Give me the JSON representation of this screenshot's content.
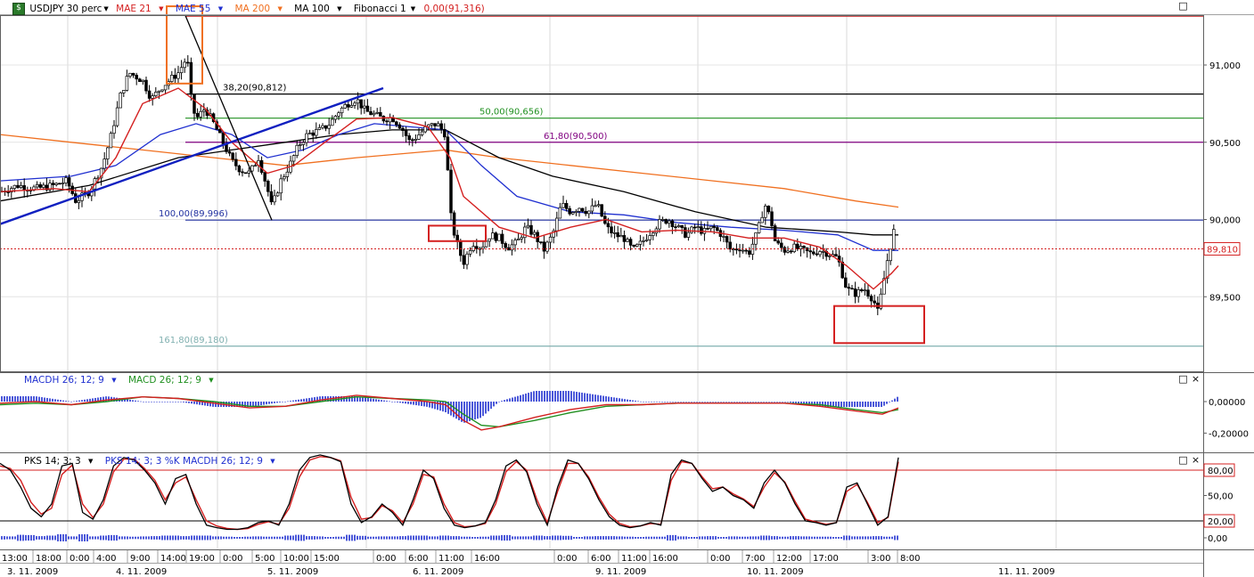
{
  "chart_data": [
    {
      "type": "candlestick",
      "title": "USDJPY 30 perc",
      "indicators": [
        {
          "name": "MAE 21",
          "color": "#d42020"
        },
        {
          "name": "MAE 55",
          "color": "#2030d0"
        },
        {
          "name": "MA 200",
          "color": "#f07020"
        },
        {
          "name": "MA 100",
          "color": "#000000"
        },
        {
          "name": "Fibonacci 1",
          "color": "#000000"
        }
      ],
      "fibonacci_value": "0,00(91,316)",
      "ylim": [
        89.08,
        91.46
      ],
      "y_ticks": [
        "91,000",
        "90,500",
        "90,000",
        "89,500"
      ],
      "y_tick_values": [
        91.0,
        90.5,
        90.0,
        89.5
      ],
      "current_price_label": "89,810",
      "current_price": 89.81,
      "fib_levels": [
        {
          "label": "0,00(91,316)",
          "value": 91.316,
          "color": "#d42020"
        },
        {
          "label": "38,20(90,812)",
          "value": 90.812,
          "color": "#000000"
        },
        {
          "label": "50,00(90,656)",
          "value": 90.656,
          "color": "#209020"
        },
        {
          "label": "61,80(90,500)",
          "value": 90.5,
          "color": "#800080"
        },
        {
          "label": "100,00(89,996)",
          "value": 89.996,
          "color": "#2030a0"
        },
        {
          "label": "161,80(89,180)",
          "value": 89.18,
          "color": "#80b0b0"
        }
      ],
      "price_path": [
        [
          0,
          90.18
        ],
        [
          20,
          90.22
        ],
        [
          40,
          90.2
        ],
        [
          60,
          90.22
        ],
        [
          75,
          90.25
        ],
        [
          85,
          90.12
        ],
        [
          100,
          90.18
        ],
        [
          115,
          90.35
        ],
        [
          125,
          90.55
        ],
        [
          135,
          90.8
        ],
        [
          145,
          90.95
        ],
        [
          160,
          90.9
        ],
        [
          170,
          90.78
        ],
        [
          180,
          90.85
        ],
        [
          190,
          90.9
        ],
        [
          200,
          90.95
        ],
        [
          210,
          91.05
        ],
        [
          215,
          90.75
        ],
        [
          220,
          90.65
        ],
        [
          230,
          90.72
        ],
        [
          240,
          90.62
        ],
        [
          250,
          90.5
        ],
        [
          260,
          90.38
        ],
        [
          270,
          90.32
        ],
        [
          280,
          90.3
        ],
        [
          290,
          90.4
        ],
        [
          300,
          90.2
        ],
        [
          305,
          90.08
        ],
        [
          315,
          90.25
        ],
        [
          325,
          90.35
        ],
        [
          335,
          90.48
        ],
        [
          345,
          90.55
        ],
        [
          360,
          90.58
        ],
        [
          370,
          90.62
        ],
        [
          380,
          90.7
        ],
        [
          390,
          90.75
        ],
        [
          400,
          90.78
        ],
        [
          410,
          90.7
        ],
        [
          420,
          90.68
        ],
        [
          430,
          90.65
        ],
        [
          440,
          90.66
        ],
        [
          450,
          90.6
        ],
        [
          460,
          90.5
        ],
        [
          470,
          90.55
        ],
        [
          480,
          90.6
        ],
        [
          490,
          90.62
        ],
        [
          500,
          90.55
        ],
        [
          505,
          90.05
        ],
        [
          510,
          89.9
        ],
        [
          515,
          89.8
        ],
        [
          520,
          89.72
        ],
        [
          530,
          89.85
        ],
        [
          540,
          89.82
        ],
        [
          550,
          89.9
        ],
        [
          560,
          89.88
        ],
        [
          570,
          89.82
        ],
        [
          580,
          89.85
        ],
        [
          590,
          89.95
        ],
        [
          600,
          89.9
        ],
        [
          610,
          89.8
        ],
        [
          620,
          89.9
        ],
        [
          630,
          90.1
        ],
        [
          640,
          90.05
        ],
        [
          650,
          90.08
        ],
        [
          660,
          90.05
        ],
        [
          670,
          90.1
        ],
        [
          680,
          89.95
        ],
        [
          690,
          89.9
        ],
        [
          700,
          89.88
        ],
        [
          710,
          89.8
        ],
        [
          720,
          89.85
        ],
        [
          730,
          89.92
        ],
        [
          740,
          89.98
        ],
        [
          750,
          90.0
        ],
        [
          760,
          89.95
        ],
        [
          770,
          89.9
        ],
        [
          780,
          89.95
        ],
        [
          790,
          89.92
        ],
        [
          800,
          89.95
        ],
        [
          810,
          89.9
        ],
        [
          820,
          89.8
        ],
        [
          830,
          89.82
        ],
        [
          840,
          89.78
        ],
        [
          850,
          89.92
        ],
        [
          858,
          90.1
        ],
        [
          865,
          90.0
        ],
        [
          870,
          89.85
        ],
        [
          880,
          89.8
        ],
        [
          890,
          89.82
        ],
        [
          900,
          89.8
        ],
        [
          910,
          89.78
        ],
        [
          920,
          89.8
        ],
        [
          930,
          89.78
        ],
        [
          940,
          89.75
        ],
        [
          950,
          89.55
        ],
        [
          960,
          89.52
        ],
        [
          970,
          89.55
        ],
        [
          980,
          89.48
        ],
        [
          985,
          89.4
        ],
        [
          990,
          89.55
        ],
        [
          995,
          89.72
        ],
        [
          1000,
          89.85
        ],
        [
          1005,
          89.98
        ],
        [
          1008,
          89.81
        ]
      ],
      "ma21_path": [
        [
          0,
          90.18
        ],
        [
          60,
          90.2
        ],
        [
          100,
          90.18
        ],
        [
          130,
          90.4
        ],
        [
          160,
          90.75
        ],
        [
          200,
          90.85
        ],
        [
          230,
          90.72
        ],
        [
          260,
          90.5
        ],
        [
          300,
          90.3
        ],
        [
          330,
          90.35
        ],
        [
          360,
          90.48
        ],
        [
          400,
          90.65
        ],
        [
          440,
          90.66
        ],
        [
          480,
          90.6
        ],
        [
          505,
          90.4
        ],
        [
          520,
          90.15
        ],
        [
          560,
          89.95
        ],
        [
          600,
          89.88
        ],
        [
          640,
          89.95
        ],
        [
          680,
          90.0
        ],
        [
          720,
          89.92
        ],
        [
          760,
          89.93
        ],
        [
          800,
          89.92
        ],
        [
          840,
          89.88
        ],
        [
          880,
          89.88
        ],
        [
          920,
          89.82
        ],
        [
          950,
          89.7
        ],
        [
          980,
          89.55
        ],
        [
          1000,
          89.65
        ],
        [
          1008,
          89.7
        ]
      ],
      "ma55_path": [
        [
          0,
          90.25
        ],
        [
          80,
          90.28
        ],
        [
          130,
          90.35
        ],
        [
          180,
          90.55
        ],
        [
          220,
          90.62
        ],
        [
          260,
          90.55
        ],
        [
          300,
          90.4
        ],
        [
          340,
          90.45
        ],
        [
          380,
          90.55
        ],
        [
          420,
          90.62
        ],
        [
          460,
          90.6
        ],
        [
          500,
          90.58
        ],
        [
          540,
          90.35
        ],
        [
          580,
          90.15
        ],
        [
          640,
          90.05
        ],
        [
          700,
          90.03
        ],
        [
          760,
          89.98
        ],
        [
          820,
          89.95
        ],
        [
          880,
          89.93
        ],
        [
          940,
          89.9
        ],
        [
          980,
          89.8
        ],
        [
          1008,
          89.8
        ]
      ],
      "ma100_path": [
        [
          0,
          90.12
        ],
        [
          100,
          90.22
        ],
        [
          200,
          90.4
        ],
        [
          260,
          90.45
        ],
        [
          320,
          90.5
        ],
        [
          380,
          90.55
        ],
        [
          440,
          90.58
        ],
        [
          500,
          90.58
        ],
        [
          560,
          90.4
        ],
        [
          620,
          90.28
        ],
        [
          700,
          90.18
        ],
        [
          780,
          90.05
        ],
        [
          860,
          89.95
        ],
        [
          940,
          89.92
        ],
        [
          980,
          89.9
        ],
        [
          1008,
          89.9
        ]
      ],
      "ma200_path": [
        [
          0,
          90.55
        ],
        [
          80,
          90.5
        ],
        [
          160,
          90.45
        ],
        [
          240,
          90.4
        ],
        [
          320,
          90.35
        ],
        [
          400,
          90.4
        ],
        [
          460,
          90.43
        ],
        [
          500,
          90.45
        ],
        [
          560,
          90.4
        ],
        [
          640,
          90.35
        ],
        [
          720,
          90.3
        ],
        [
          800,
          90.25
        ],
        [
          880,
          90.2
        ],
        [
          960,
          90.12
        ],
        [
          1008,
          90.08
        ]
      ],
      "trendline": {
        "x1": 0,
        "y1": 89.97,
        "x2": 430,
        "y2": 90.85
      },
      "swing_line": [
        [
          208,
          91.32
        ],
        [
          305,
          89.996
        ]
      ],
      "highlight_boxes": [
        {
          "x": 187,
          "w": 40,
          "top": 91.38,
          "bottom": 90.88,
          "color": "#f07020"
        },
        {
          "x": 481,
          "w": 64,
          "top": 89.96,
          "bottom": 89.86,
          "color": "#d42020"
        },
        {
          "x": 936,
          "w": 101,
          "top": 89.44,
          "bottom": 89.2,
          "color": "#d42020"
        }
      ]
    },
    {
      "type": "macd",
      "indicators": [
        {
          "name": "MACDH 26; 12; 9",
          "color": "#2030d0"
        },
        {
          "name": "MACD 26; 12; 9",
          "color": "#209020"
        }
      ],
      "y_ticks": [
        "0,00000",
        "-0,20000"
      ],
      "y_tick_values": [
        0.0,
        -0.2
      ],
      "ylim": [
        -0.29,
        0.1
      ],
      "macd_path": [
        [
          0,
          -0.01
        ],
        [
          40,
          0.0
        ],
        [
          80,
          -0.02
        ],
        [
          120,
          0.01
        ],
        [
          160,
          0.03
        ],
        [
          200,
          0.02
        ],
        [
          240,
          -0.01
        ],
        [
          280,
          -0.04
        ],
        [
          320,
          -0.03
        ],
        [
          360,
          0.01
        ],
        [
          400,
          0.04
        ],
        [
          440,
          0.02
        ],
        [
          480,
          0.0
        ],
        [
          500,
          -0.02
        ],
        [
          520,
          -0.12
        ],
        [
          540,
          -0.18
        ],
        [
          560,
          -0.16
        ],
        [
          600,
          -0.1
        ],
        [
          640,
          -0.05
        ],
        [
          680,
          -0.02
        ],
        [
          720,
          -0.02
        ],
        [
          760,
          -0.01
        ],
        [
          800,
          -0.01
        ],
        [
          840,
          -0.01
        ],
        [
          880,
          -0.01
        ],
        [
          920,
          -0.03
        ],
        [
          960,
          -0.06
        ],
        [
          990,
          -0.08
        ],
        [
          1008,
          -0.04
        ]
      ],
      "signal_path": [
        [
          0,
          -0.02
        ],
        [
          40,
          -0.01
        ],
        [
          80,
          -0.02
        ],
        [
          120,
          0.0
        ],
        [
          160,
          0.03
        ],
        [
          200,
          0.02
        ],
        [
          240,
          0.0
        ],
        [
          280,
          -0.03
        ],
        [
          320,
          -0.03
        ],
        [
          360,
          0.0
        ],
        [
          400,
          0.03
        ],
        [
          440,
          0.02
        ],
        [
          480,
          0.01
        ],
        [
          500,
          0.0
        ],
        [
          520,
          -0.08
        ],
        [
          540,
          -0.15
        ],
        [
          560,
          -0.16
        ],
        [
          600,
          -0.12
        ],
        [
          640,
          -0.07
        ],
        [
          680,
          -0.03
        ],
        [
          720,
          -0.02
        ],
        [
          760,
          -0.01
        ],
        [
          800,
          -0.01
        ],
        [
          840,
          -0.01
        ],
        [
          880,
          -0.01
        ],
        [
          920,
          -0.02
        ],
        [
          960,
          -0.05
        ],
        [
          990,
          -0.07
        ],
        [
          1008,
          -0.05
        ]
      ]
    },
    {
      "type": "stochastic",
      "indicators": [
        {
          "name": "PKS 14; 3; 3",
          "color": "#000000"
        },
        {
          "name": "PKS 14; 3; 3 %K MACDH 26; 12; 9",
          "color": "#2030d0"
        }
      ],
      "y_ticks": [
        "80,00",
        "50,00",
        "20,00",
        "0,00"
      ],
      "y_tick_values": [
        80,
        50,
        20,
        0
      ],
      "ylim": [
        -12,
        107
      ],
      "levels": [
        80,
        20
      ],
      "k_values": [
        88,
        80,
        60,
        35,
        25,
        40,
        85,
        88,
        30,
        22,
        45,
        85,
        95,
        92,
        80,
        65,
        40,
        70,
        75,
        40,
        15,
        12,
        10,
        10,
        12,
        18,
        20,
        15,
        40,
        80,
        95,
        98,
        95,
        90,
        40,
        18,
        25,
        40,
        30,
        15,
        45,
        80,
        70,
        35,
        15,
        12,
        14,
        18,
        45,
        85,
        92,
        78,
        40,
        15,
        60,
        92,
        88,
        70,
        45,
        25,
        15,
        12,
        14,
        18,
        15,
        75,
        92,
        88,
        70,
        55,
        60,
        50,
        45,
        35,
        65,
        80,
        65,
        40,
        20,
        18,
        15,
        18,
        60,
        65,
        40,
        15,
        25,
        95
      ],
      "d_values": [
        85,
        82,
        68,
        42,
        28,
        35,
        75,
        86,
        40,
        24,
        40,
        78,
        93,
        93,
        82,
        68,
        45,
        65,
        72,
        45,
        20,
        14,
        11,
        10,
        11,
        16,
        19,
        16,
        35,
        72,
        92,
        96,
        95,
        91,
        48,
        22,
        24,
        38,
        32,
        18,
        40,
        75,
        72,
        40,
        18,
        13,
        14,
        17,
        40,
        78,
        90,
        80,
        45,
        18,
        55,
        88,
        88,
        72,
        48,
        28,
        17,
        13,
        14,
        17,
        16,
        68,
        90,
        88,
        72,
        58,
        60,
        52,
        46,
        37,
        60,
        77,
        66,
        43,
        22,
        19,
        16,
        18,
        55,
        63,
        42,
        18,
        24,
        90
      ]
    }
  ],
  "x_axis": {
    "time_labels": [
      "13:00",
      "18:00",
      "0:00",
      "4:00",
      "9:00",
      "14:00",
      "19:00",
      "0:00",
      "5:00",
      "10:00",
      "15:00",
      "0:00",
      "6:00",
      "11:00",
      "16:00",
      "0:00",
      "6:00",
      "11:00",
      "16:00",
      "0:00",
      "7:00",
      "12:00",
      "17:00",
      "3:00",
      "8:00"
    ],
    "date_labels": [
      "3. 11. 2009",
      "4. 11. 2009",
      "5. 11. 2009",
      "6. 11. 2009",
      "9. 11. 2009",
      "10. 11. 2009",
      "11. 11. 2009"
    ]
  },
  "buttons": {
    "maximize": "□",
    "close": "×"
  },
  "icons": {
    "app": "chart-app-icon",
    "dropdown": "dropdown-arrow-icon"
  },
  "colors": {
    "grid": "#c8c8c8",
    "divider": "#606060",
    "price_line": "#d42020"
  }
}
